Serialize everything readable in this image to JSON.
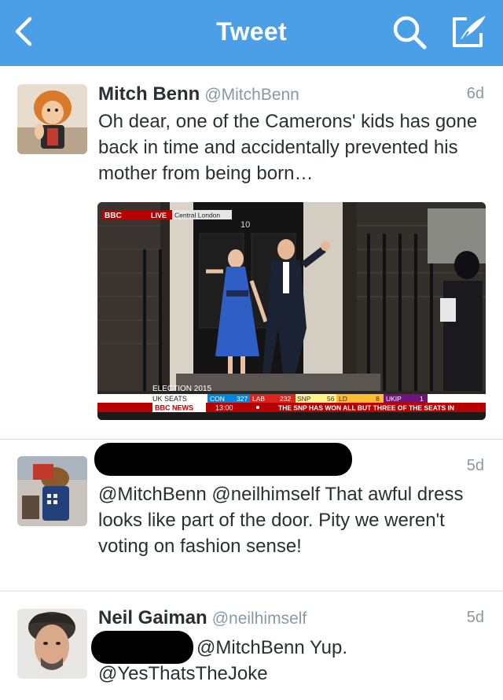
{
  "nav": {
    "title": "Tweet",
    "back_icon": "chevron-left-icon",
    "search_icon": "search-icon",
    "compose_icon": "compose-icon",
    "color": "#4a9fe6"
  },
  "tweets": [
    {
      "name": "Mitch Benn",
      "handle": "@MitchBenn",
      "time": "6d",
      "text": "Oh dear, one of the Camerons' kids has gone back in time and accidentally prevented his mother from being born…",
      "media": {
        "bbc_logo": "BBC",
        "live": "LIVE",
        "location": "Central London",
        "door_number": "10",
        "election_label": "ELECTION 2015",
        "uk_seats": "UK SEATS",
        "parties": [
          {
            "name": "CON",
            "seats": "327"
          },
          {
            "name": "LAB",
            "seats": "232"
          },
          {
            "name": "SNP",
            "seats": "56"
          },
          {
            "name": "LD",
            "seats": "8"
          },
          {
            "name": "UKIP",
            "seats": "1"
          }
        ],
        "news_label": "BBC NEWS",
        "clock": "13:00",
        "ticker": "THE SNP HAS WON ALL BUT THREE OF THE SEATS IN"
      }
    },
    {
      "name": "",
      "handle": "",
      "time": "5d",
      "text": "@MitchBenn @neilhimself That awful dress looks like part of the door. Pity we weren't voting on fashion sense!"
    },
    {
      "name": "Neil Gaiman",
      "handle": "@neilhimself",
      "time": "5d",
      "text_line1": "@MitchBenn Yup.",
      "text_line2": "@YesThatsTheJoke"
    }
  ]
}
